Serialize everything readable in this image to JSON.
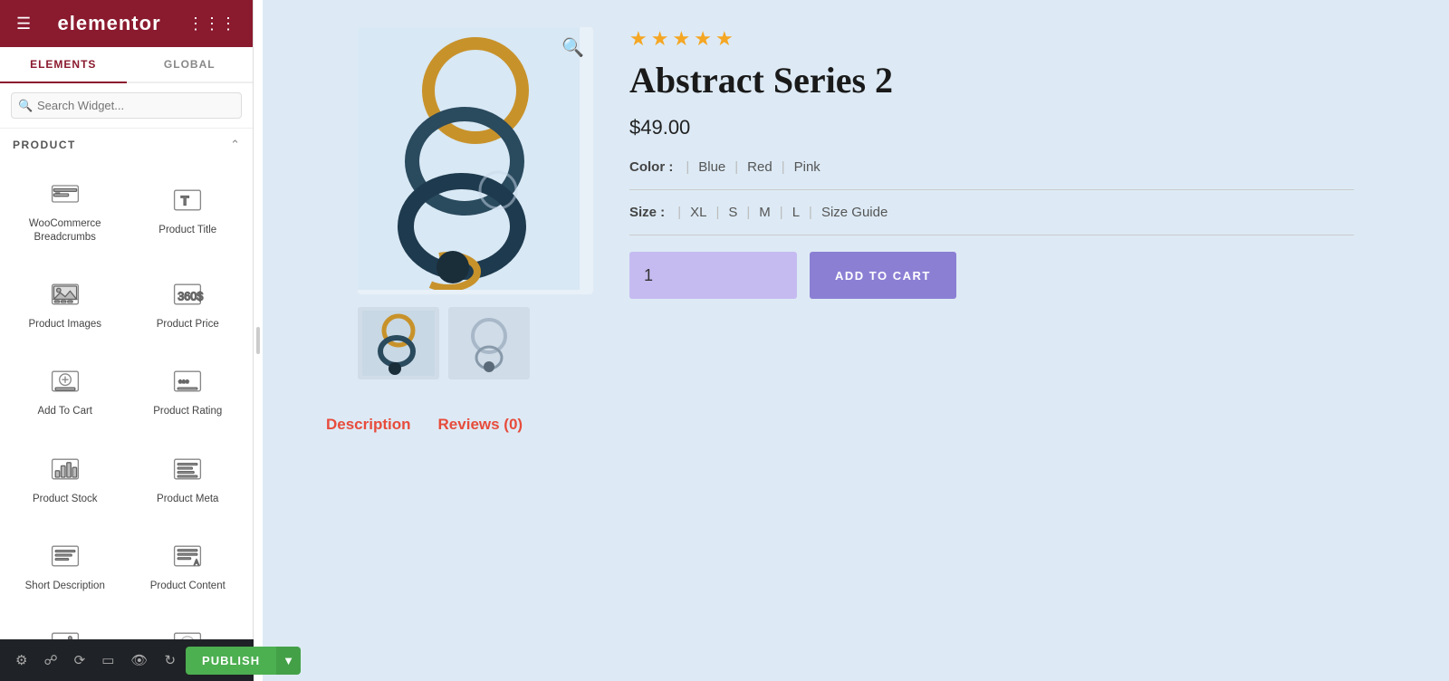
{
  "sidebar": {
    "logo": "elementor",
    "tabs": [
      {
        "id": "elements",
        "label": "ELEMENTS",
        "active": true
      },
      {
        "id": "global",
        "label": "GLOBAL",
        "active": false
      }
    ],
    "search": {
      "placeholder": "Search Widget..."
    },
    "section": {
      "title": "PRODUCT",
      "collapsed": false
    },
    "widgets": [
      {
        "id": "woocommerce-breadcrumbs",
        "label": "WooCommerce Breadcrumbs",
        "icon": "breadcrumb-icon"
      },
      {
        "id": "product-title",
        "label": "Product Title",
        "icon": "product-title-icon"
      },
      {
        "id": "product-images",
        "label": "Product Images",
        "icon": "product-images-icon"
      },
      {
        "id": "product-price",
        "label": "Product Price",
        "icon": "product-price-icon"
      },
      {
        "id": "add-to-cart",
        "label": "Add To Cart",
        "icon": "add-to-cart-icon"
      },
      {
        "id": "product-rating",
        "label": "Product Rating",
        "icon": "product-rating-icon"
      },
      {
        "id": "product-stock",
        "label": "Product Stock",
        "icon": "product-stock-icon"
      },
      {
        "id": "product-meta",
        "label": "Product Meta",
        "icon": "product-meta-icon"
      },
      {
        "id": "short-description",
        "label": "Short Description",
        "icon": "short-description-icon"
      },
      {
        "id": "product-content",
        "label": "Product Content",
        "icon": "product-content-icon"
      },
      {
        "id": "widget-11",
        "label": "",
        "icon": "widget-11-icon"
      },
      {
        "id": "widget-12",
        "label": "",
        "icon": "widget-12-icon"
      }
    ]
  },
  "toolbar": {
    "icons": [
      "settings",
      "layers",
      "history",
      "responsive",
      "eye",
      "redo"
    ],
    "publish_label": "PUBLISH"
  },
  "product": {
    "stars": 5,
    "title": "Abstract Series 2",
    "price": "$49.00",
    "color_label": "Color :",
    "colors": [
      "Blue",
      "Red",
      "Pink"
    ],
    "size_label": "Size :",
    "sizes": [
      "XL",
      "S",
      "M",
      "L"
    ],
    "size_guide": "Size Guide",
    "quantity": "1",
    "add_to_cart": "ADD TO CART",
    "tabs": [
      "Description",
      "Reviews (0)"
    ]
  }
}
